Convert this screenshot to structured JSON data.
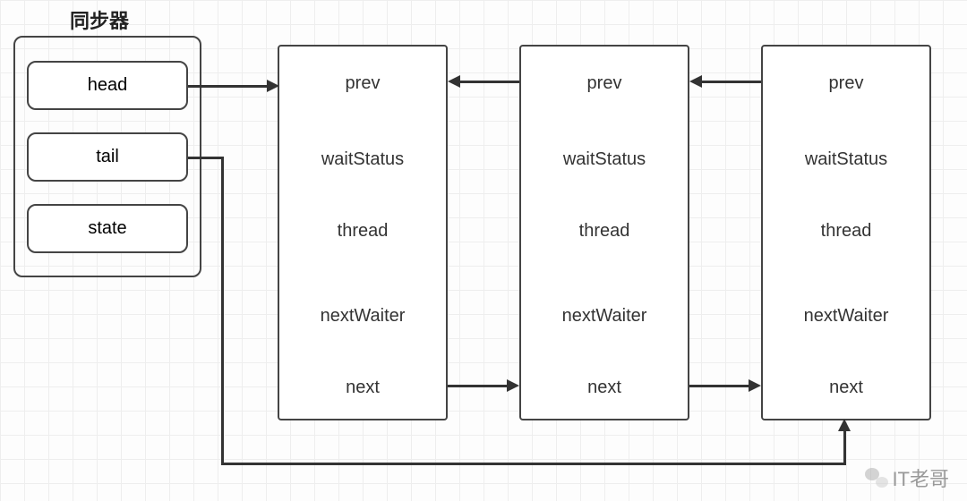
{
  "title": "同步器",
  "synchronizer": {
    "fields": [
      "head",
      "tail",
      "state"
    ]
  },
  "node_fields": [
    "prev",
    "waitStatus",
    "thread",
    "nextWaiter",
    "next"
  ],
  "watermark": "IT老哥",
  "chart_data": {
    "type": "diagram",
    "title": "同步器 (Synchronizer / AQS queue structure)",
    "synchronizer_fields": [
      "head",
      "tail",
      "state"
    ],
    "queue_node_fields": [
      "prev",
      "waitStatus",
      "thread",
      "nextWaiter",
      "next"
    ],
    "nodes": [
      {
        "id": "node1"
      },
      {
        "id": "node2"
      },
      {
        "id": "node3"
      }
    ],
    "pointers": [
      {
        "from": "synchronizer.head",
        "to": "node1",
        "field": "head"
      },
      {
        "from": "synchronizer.tail",
        "to": "node3",
        "field": "tail",
        "routing": "below"
      },
      {
        "from": "node2.prev",
        "to": "node1"
      },
      {
        "from": "node3.prev",
        "to": "node2"
      },
      {
        "from": "node1.next",
        "to": "node2"
      },
      {
        "from": "node2.next",
        "to": "node3"
      }
    ],
    "annotations": [
      "IT老哥 (WeChat watermark)"
    ]
  }
}
